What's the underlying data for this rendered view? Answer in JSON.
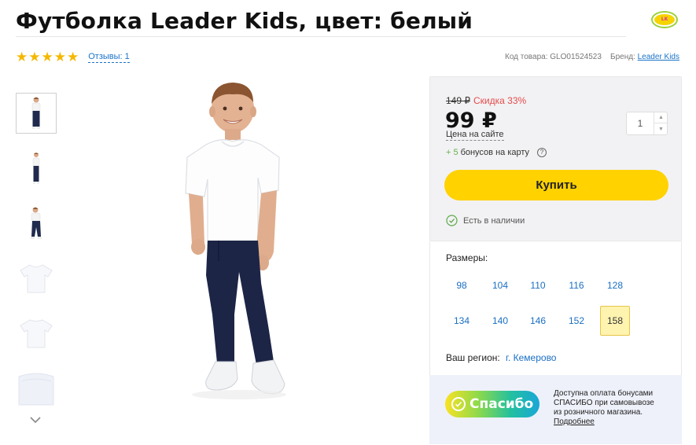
{
  "product": {
    "title": "Футболка Leader Kids, цвет: белый",
    "rating_stars": 5,
    "reviews_link": "Отзывы: 1",
    "code_label": "Код товара:",
    "code_value": "GLO01524523",
    "brand_label": "Бренд:",
    "brand_link": "Leader Kids",
    "brand_logo_text": "Leader Kids"
  },
  "gallery": {
    "thumbnails": [
      "boy-front",
      "boy-front-2",
      "boy-side",
      "tshirt-front",
      "tshirt-back",
      "tshirt-fabric"
    ],
    "selected_index": 0,
    "scroll_down_icon": "chevron-down-icon"
  },
  "buy": {
    "old_price": "149 ₽",
    "discount": "Скидка 33%",
    "price": "99 ₽",
    "price_note": "Цена на сайте",
    "bonus_plus": "+",
    "bonus_amount": "5",
    "bonus_text": "бонусов на карту",
    "quantity": "1",
    "buy_button": "Купить",
    "stock_status": "Есть в наличии"
  },
  "sizes": {
    "label": "Размеры:",
    "options": [
      "98",
      "104",
      "110",
      "116",
      "128",
      "134",
      "140",
      "146",
      "152",
      "158"
    ],
    "selected": "158"
  },
  "region": {
    "label": "Ваш регион:",
    "value": "г. Кемерово"
  },
  "spasibo": {
    "badge_text": "Спасибо",
    "info_line1": "Доступна оплата бонусами",
    "info_line2": "СПАСИБО при самовывозе",
    "info_line3": "из розничного магазина.",
    "more_link": "Подробнее"
  },
  "colors": {
    "accent_yellow": "#ffd200",
    "link_blue": "#1a73c8",
    "discount_red": "#e54b4b",
    "bonus_green": "#6ab04c",
    "star": "#f5b800"
  }
}
